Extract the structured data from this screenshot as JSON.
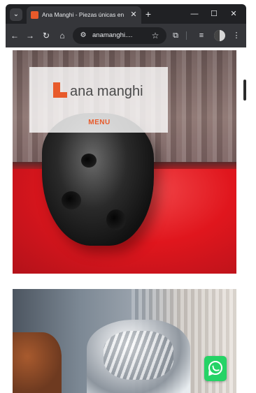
{
  "browser": {
    "tab_title": "Ana Manghi - Piezas únicas en",
    "url": "anamanghi....",
    "icons": {
      "tab_search": "chevron-down-icon",
      "tab_close": "close-icon",
      "new_tab": "plus-icon",
      "back": "arrow-left-icon",
      "forward": "arrow-right-icon",
      "reload": "reload-icon",
      "home": "home-icon",
      "site_info": "tune-icon",
      "bookmark": "star-icon",
      "extensions": "puzzle-icon",
      "media": "media-control-icon",
      "menu": "kebab-icon"
    },
    "glyphs": {
      "tab_search": "⌄",
      "tab_close": "✕",
      "new_tab": "+",
      "minimize": "—",
      "maximize": "☐",
      "close": "✕",
      "back": "←",
      "forward": "→",
      "reload": "↻",
      "home": "⌂",
      "site_info": "⚙",
      "star": "☆",
      "extensions": "⧉",
      "media": "≡",
      "kebab": "⋮"
    }
  },
  "site": {
    "logo_text": "ana manghi",
    "menu_label": "MENU",
    "brand_color": "#e85a2a"
  },
  "products": [
    {
      "image": "black ceramic vase on red surface"
    },
    {
      "image": "clear glass vase"
    }
  ],
  "widgets": {
    "whatsapp_icon": "whatsapp-icon",
    "whatsapp_color": "#25d366"
  }
}
